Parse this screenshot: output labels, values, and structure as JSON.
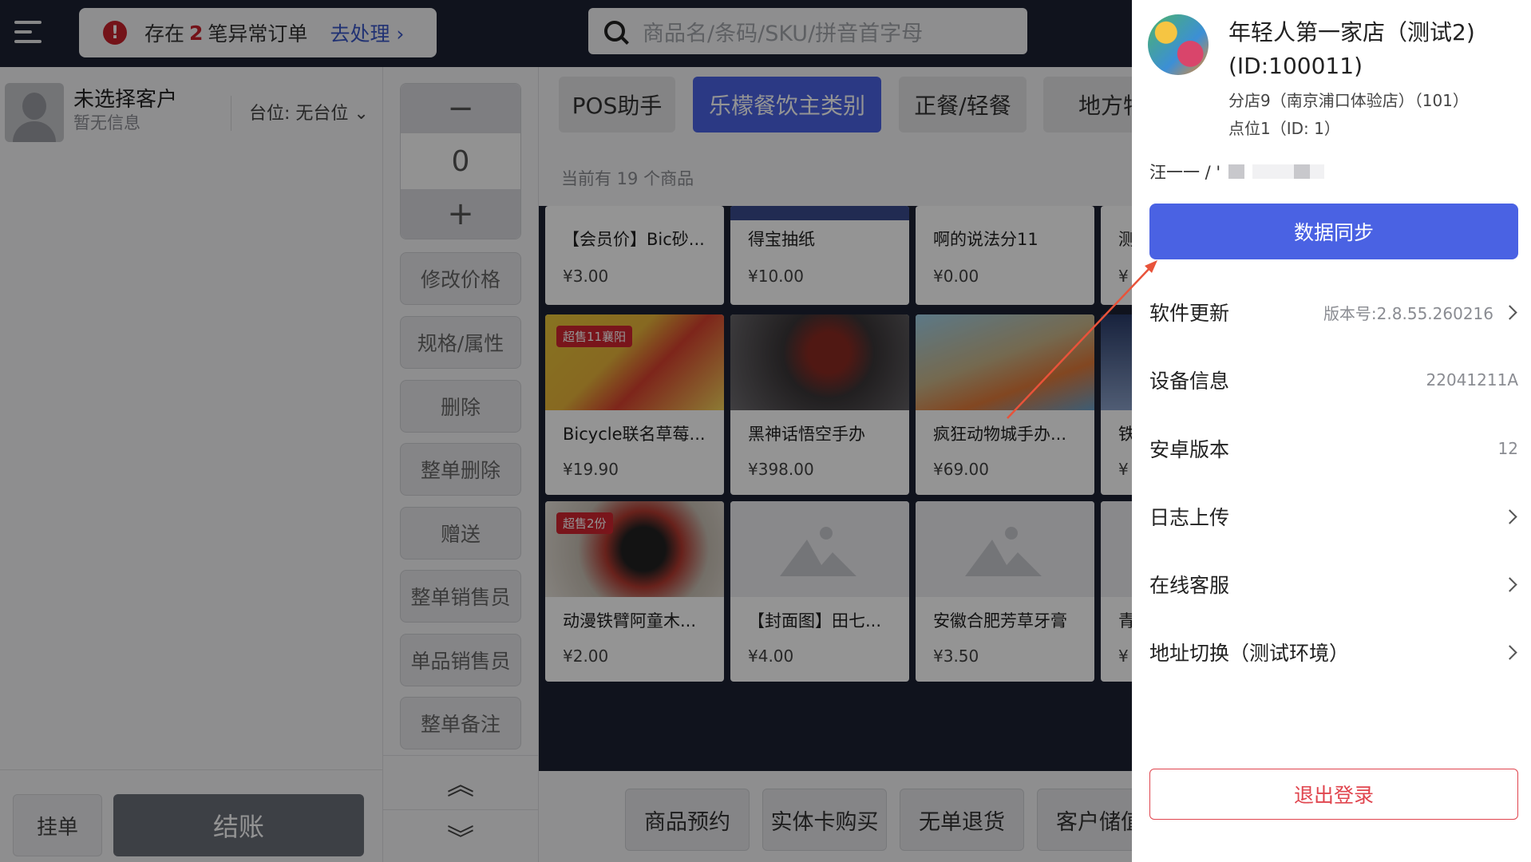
{
  "topbar": {
    "alert_prefix": "存在",
    "alert_count": "2",
    "alert_suffix": "笔异常订单",
    "alert_link": "去处理 ›",
    "search_placeholder": "商品名/条码/SKU/拼音首字母"
  },
  "customer": {
    "name": "未选择客户",
    "sub": "暂无信息",
    "table": "台位:  无台位 ⌄"
  },
  "quantity": {
    "minus": "−",
    "value": "0",
    "plus": "+"
  },
  "actions": [
    "修改价格",
    "规格/属性",
    "删除",
    "整单删除",
    "赠送",
    "整单销售员",
    "单品销售员",
    "整单备注"
  ],
  "scroll": {
    "up": "︽",
    "down": "︾"
  },
  "footer": {
    "hold": "挂单",
    "pay": "结账"
  },
  "categories": [
    "POS助手",
    "乐檬餐饮主类别",
    "正餐/轻餐",
    "地方特产"
  ],
  "product_count": "当前有 19 个商品",
  "products": [
    {
      "name": "【会员价】Bic砂...",
      "price": "¥3.00"
    },
    {
      "name": "得宝抽纸",
      "price": "¥10.00"
    },
    {
      "name": "啊的说法分11",
      "price": "¥0.00"
    },
    {
      "name": "测",
      "price": "¥"
    },
    {
      "name": "Bicycle联名草莓...",
      "price": "¥19.90",
      "badge": "超售11襄阳"
    },
    {
      "name": "黑神话悟空手办",
      "price": "¥398.00"
    },
    {
      "name": "疯狂动物城手办...",
      "price": "¥69.00"
    },
    {
      "name": "铁",
      "price": "¥"
    },
    {
      "name": "动漫铁臂阿童木...",
      "price": "¥2.00",
      "badge": "超售2份"
    },
    {
      "name": "【封面图】田七...",
      "price": "¥4.00"
    },
    {
      "name": "安徽合肥芳草牙膏",
      "price": "¥3.50"
    },
    {
      "name": "青",
      "price": "¥"
    }
  ],
  "bottom_actions": [
    "商品预约",
    "实体卡购买",
    "无单退货",
    "客户储值"
  ],
  "drawer": {
    "store_name": "年轻人第一家店（测试2)(ID:100011)",
    "branch": "分店9（南京浦口体验店）（101）",
    "point": "点位1（ID: 1）",
    "operator": "汪一一 / '",
    "sync_button": "数据同步",
    "rows": [
      {
        "label": "软件更新",
        "value": "版本号:2.8.55.260216",
        "chevron": true
      },
      {
        "label": "设备信息",
        "value": "22041211A",
        "chevron": false
      },
      {
        "label": "安卓版本",
        "value": "12",
        "chevron": false
      },
      {
        "label": "日志上传",
        "value": "",
        "chevron": true
      },
      {
        "label": "在线客服",
        "value": "",
        "chevron": true
      },
      {
        "label": "地址切换（测试环境）",
        "value": "",
        "chevron": true
      }
    ],
    "logout_button": "退出登录"
  },
  "colors": {
    "accent": "#4a62e3",
    "danger": "#e0454e",
    "dark_bar": "#1d2233",
    "annotation_arrow": "#e8533a"
  }
}
